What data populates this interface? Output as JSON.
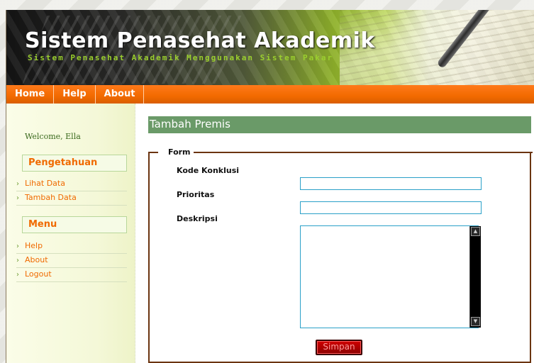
{
  "header": {
    "title": "Sistem Penasehat Akademik",
    "subtitle": "Sistem Penasehat Akademik Menggunakan Sistem Pakar"
  },
  "nav": {
    "items": [
      {
        "label": "Home"
      },
      {
        "label": "Help"
      },
      {
        "label": "About"
      }
    ]
  },
  "sidebar": {
    "welcome": "Welcome, Ella",
    "sections": [
      {
        "title": "Pengetahuan",
        "links": [
          "Lihat Data",
          "Tambah Data"
        ]
      },
      {
        "title": "Menu",
        "links": [
          "Help",
          "About",
          "Logout"
        ]
      }
    ]
  },
  "main": {
    "title": "Tambah Premis",
    "form": {
      "legend": "Form",
      "fields": [
        {
          "label": "Kode Konklusi",
          "value": ""
        },
        {
          "label": "Prioritas",
          "value": ""
        },
        {
          "label": "Deskripsi",
          "value": ""
        }
      ],
      "submit_label": "Simpan"
    }
  },
  "colors": {
    "accent_orange": "#f26a00",
    "title_bar_green": "#6a9a68",
    "form_border_brown": "#6b3410",
    "submit_red": "#b30000"
  }
}
